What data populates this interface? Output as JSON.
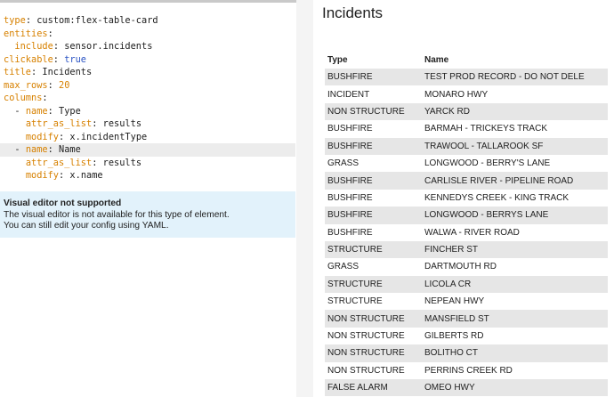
{
  "editor": {
    "yaml_lines": [
      {
        "key": "type",
        "sep": ": ",
        "value": "custom:flex-table-card",
        "indent": "",
        "prefix": "",
        "value_type": "plain"
      },
      {
        "key": "entities",
        "sep": ":",
        "value": "",
        "indent": "",
        "prefix": "",
        "value_type": "plain"
      },
      {
        "key": "include",
        "sep": ": ",
        "value": "sensor.incidents",
        "indent": "  ",
        "prefix": "",
        "value_type": "plain"
      },
      {
        "key": "clickable",
        "sep": ": ",
        "value": "true",
        "indent": "",
        "prefix": "",
        "value_type": "bool"
      },
      {
        "key": "title",
        "sep": ": ",
        "value": "Incidents",
        "indent": "",
        "prefix": "",
        "value_type": "plain"
      },
      {
        "key": "max_rows",
        "sep": ": ",
        "value": "20",
        "indent": "",
        "prefix": "",
        "value_type": "number"
      },
      {
        "key": "columns",
        "sep": ":",
        "value": "",
        "indent": "",
        "prefix": "",
        "value_type": "plain"
      },
      {
        "key": "name",
        "sep": ": ",
        "value": "Type",
        "indent": "  ",
        "prefix": "- ",
        "value_type": "plain"
      },
      {
        "key": "attr_as_list",
        "sep": ": ",
        "value": "results",
        "indent": "    ",
        "prefix": "",
        "value_type": "plain"
      },
      {
        "key": "modify",
        "sep": ": ",
        "value": "x.incidentType",
        "indent": "    ",
        "prefix": "",
        "value_type": "plain"
      },
      {
        "key": "name",
        "sep": ": ",
        "value": "Name",
        "indent": "  ",
        "prefix": "- ",
        "value_type": "plain"
      },
      {
        "key": "attr_as_list",
        "sep": ": ",
        "value": "results",
        "indent": "    ",
        "prefix": "",
        "value_type": "plain"
      },
      {
        "key": "modify",
        "sep": ": ",
        "value": "x.name",
        "indent": "    ",
        "prefix": "",
        "value_type": "plain"
      }
    ],
    "active_line": 10
  },
  "notice": {
    "title": "Visual editor not supported",
    "line1": "The visual editor is not available for this type of element.",
    "line2": "You can still edit your config using YAML."
  },
  "card": {
    "title": "Incidents",
    "columns": [
      "Type",
      "Name"
    ],
    "rows": [
      [
        "BUSHFIRE",
        "TEST PROD RECORD - DO NOT DELE"
      ],
      [
        "INCIDENT",
        "MONARO HWY"
      ],
      [
        "NON STRUCTURE",
        "YARCK RD"
      ],
      [
        "BUSHFIRE",
        "BARMAH - TRICKEYS TRACK"
      ],
      [
        "BUSHFIRE",
        "TRAWOOL - TALLAROOK SF"
      ],
      [
        "GRASS",
        "LONGWOOD - BERRY'S LANE"
      ],
      [
        "BUSHFIRE",
        "CARLISLE RIVER - PIPELINE ROAD"
      ],
      [
        "BUSHFIRE",
        "KENNEDYS CREEK - KING TRACK"
      ],
      [
        "BUSHFIRE",
        "LONGWOOD - BERRYS LANE"
      ],
      [
        "BUSHFIRE",
        "WALWA - RIVER ROAD"
      ],
      [
        "STRUCTURE",
        "FINCHER ST"
      ],
      [
        "GRASS",
        "DARTMOUTH RD"
      ],
      [
        "STRUCTURE",
        "LICOLA CR"
      ],
      [
        "STRUCTURE",
        "NEPEAN HWY"
      ],
      [
        "NON STRUCTURE",
        "MANSFIELD ST"
      ],
      [
        "NON STRUCTURE",
        "GILBERTS RD"
      ],
      [
        "NON STRUCTURE",
        "BOLITHO CT"
      ],
      [
        "NON STRUCTURE",
        "PERRINS CREEK RD"
      ],
      [
        "FALSE ALARM",
        "OMEO HWY"
      ]
    ]
  },
  "colors": {
    "yaml_key": "#d78100",
    "yaml_bool": "#2b54c4",
    "notice_bg": "#e2f2fb",
    "row_stripe": "#e6e6e6"
  }
}
